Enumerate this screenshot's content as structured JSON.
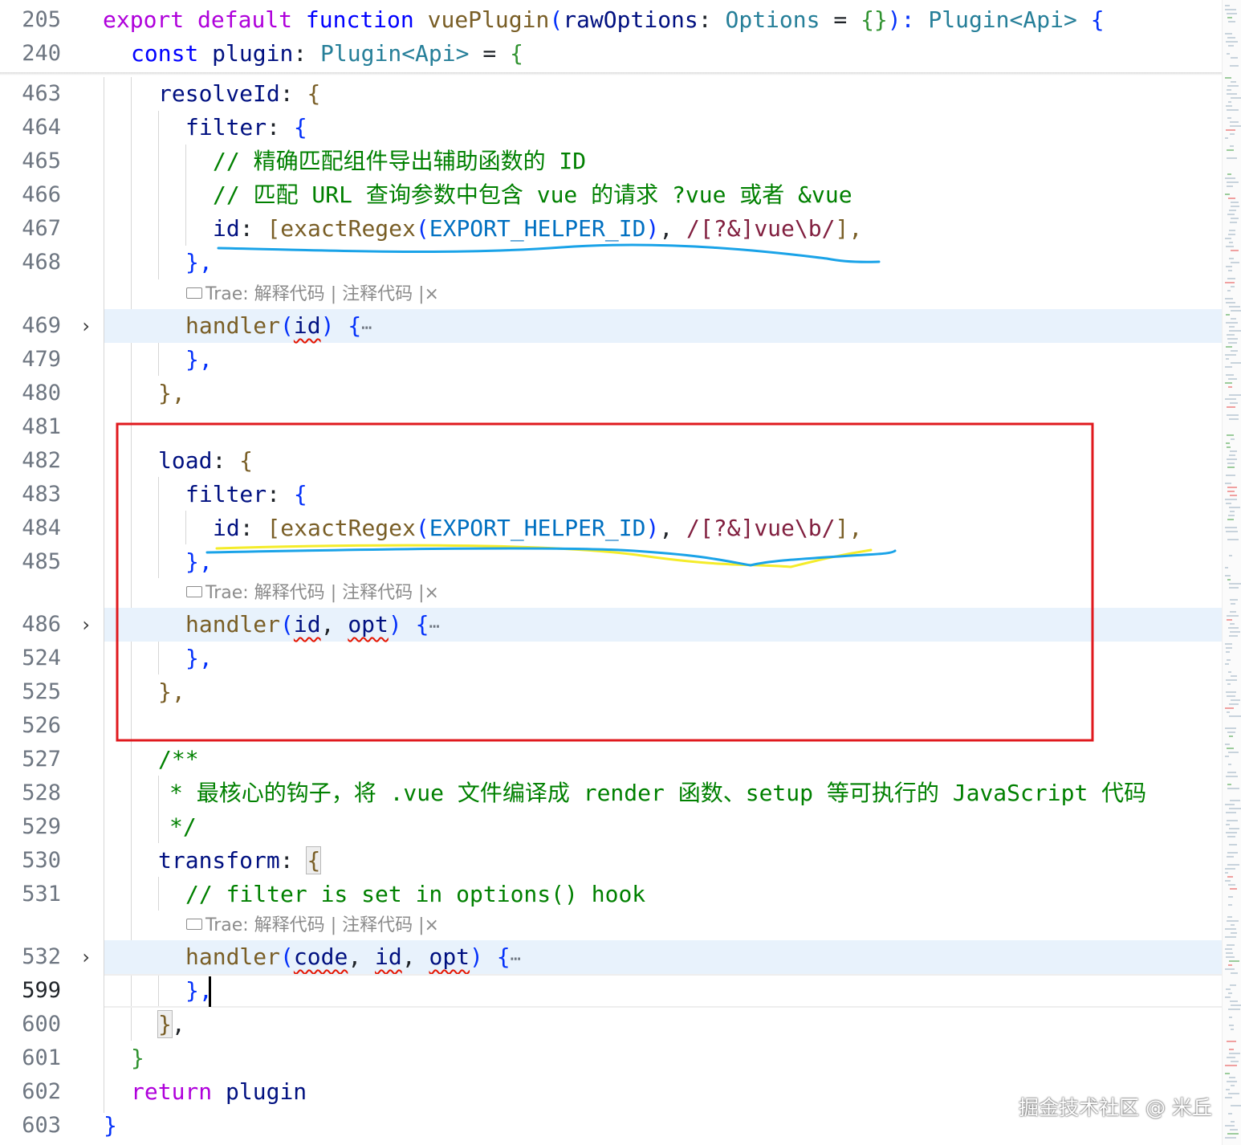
{
  "sticky_header": [
    {
      "line_no": "205",
      "t1": "export",
      "t2": "default",
      "t3": "function",
      "t4": "vuePlugin",
      "t5": "(",
      "t6": "rawOptions",
      "t7": ":",
      "t8": "Options",
      "t9": "=",
      "t10": "{}",
      "t11": "):",
      "t12": "Plugin",
      "t13": "<",
      "t14": "Api",
      "t15": ">",
      "t16": "{"
    },
    {
      "line_no": "240",
      "t1": "const",
      "t2": "plugin",
      "t3": ":",
      "t4": "Plugin",
      "t5": "<",
      "t6": "Api",
      "t7": ">",
      "t8": "=",
      "t9": "{"
    }
  ],
  "lines": {
    "l463": {
      "no": "463",
      "a": "resolveId",
      "b": ":",
      "c": "{"
    },
    "l464": {
      "no": "464",
      "a": "filter",
      "b": ":",
      "c": "{"
    },
    "l465": {
      "no": "465",
      "a": "// 精确匹配组件导出辅助函数的 ID"
    },
    "l466": {
      "no": "466",
      "a": "// 匹配 URL 查询参数中包含 vue 的请求 ?vue 或者 &vue"
    },
    "l467": {
      "no": "467",
      "a": "id",
      "b": ":",
      "c": "[",
      "d": "exactRegex",
      "e": "(",
      "f": "EXPORT_HELPER_ID",
      "g": ")",
      "h": ",",
      "i": "/[?&]vue\\b/",
      "j": "],"
    },
    "l468": {
      "no": "468",
      "a": "},"
    },
    "l469": {
      "no": "469",
      "a": "handler",
      "b": "(",
      "c": "id",
      "d": ")",
      "e": "{",
      "f": "⋯"
    },
    "l479": {
      "no": "479",
      "a": "},"
    },
    "l480": {
      "no": "480",
      "a": "},"
    },
    "l481": {
      "no": "481"
    },
    "l482": {
      "no": "482",
      "a": "load",
      "b": ":",
      "c": "{"
    },
    "l483": {
      "no": "483",
      "a": "filter",
      "b": ":",
      "c": "{"
    },
    "l484": {
      "no": "484",
      "a": "id",
      "b": ":",
      "c": "[",
      "d": "exactRegex",
      "e": "(",
      "f": "EXPORT_HELPER_ID",
      "g": ")",
      "h": ",",
      "i": "/[?&]vue\\b/",
      "j": "],"
    },
    "l485": {
      "no": "485",
      "a": "},"
    },
    "l486": {
      "no": "486",
      "a": "handler",
      "b": "(",
      "c": "id",
      "d": ",",
      "e": "opt",
      "f": ")",
      "g": "{",
      "h": "⋯"
    },
    "l524": {
      "no": "524",
      "a": "},"
    },
    "l525": {
      "no": "525",
      "a": "},"
    },
    "l526": {
      "no": "526"
    },
    "l527": {
      "no": "527",
      "a": "/**"
    },
    "l528": {
      "no": "528",
      "a": "* 最核心的钩子，将 .vue 文件编译成 render 函数、setup 等可执行的 JavaScript 代码"
    },
    "l529": {
      "no": "529",
      "a": "*/"
    },
    "l530": {
      "no": "530",
      "a": "transform",
      "b": ":",
      "c": "{"
    },
    "l531": {
      "no": "531",
      "a": "// filter is set in options() hook"
    },
    "l532": {
      "no": "532",
      "a": "handler",
      "b": "(",
      "c": "code",
      "d": ",",
      "e": "id",
      "f": ",",
      "g": "opt",
      "h": ")",
      "i": "{",
      "j": "⋯"
    },
    "l599": {
      "no": "599",
      "a": "},"
    },
    "l600": {
      "no": "600",
      "a": "}",
      "b": ","
    },
    "l601": {
      "no": "601",
      "a": "}"
    },
    "l602": {
      "no": "602",
      "a": "return",
      "b": "plugin"
    },
    "l603": {
      "no": "603",
      "a": "}"
    }
  },
  "codelens": {
    "prefix": "Trae: ",
    "explain": "解释代码",
    "separator": "|",
    "comment": "注释代码",
    "close": "×"
  },
  "fold_icon": "chevron-right-icon",
  "watermark": "掘金技术社区 @ 米丘",
  "annotation_colors": {
    "box": "#e0191e",
    "blue_underline": "#1aa3e8",
    "yellow_underline": "#f4ec2a"
  }
}
